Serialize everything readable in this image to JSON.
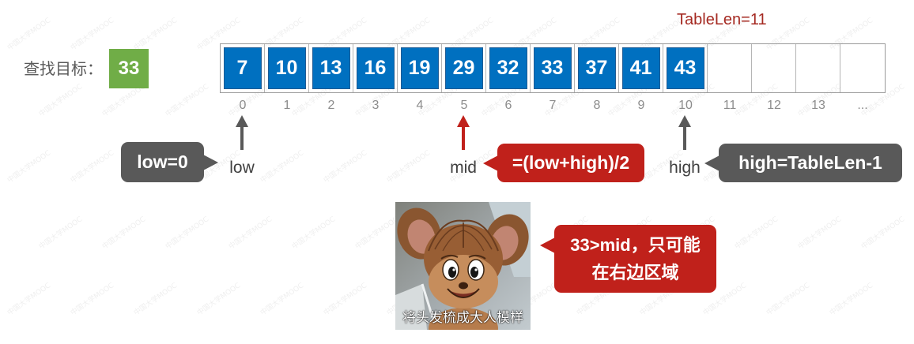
{
  "slide": {
    "table_len_label": "TableLen=11"
  },
  "search": {
    "label": "查找目标：",
    "target": "33"
  },
  "array": {
    "values": [
      "7",
      "10",
      "13",
      "16",
      "19",
      "29",
      "32",
      "33",
      "37",
      "41",
      "43"
    ],
    "indices": [
      "0",
      "1",
      "2",
      "3",
      "4",
      "5",
      "6",
      "7",
      "8",
      "9",
      "10",
      "11",
      "12",
      "13",
      "..."
    ]
  },
  "pointers": {
    "low": {
      "label": "low",
      "index": 0,
      "callout": "low=0",
      "color": "#595959"
    },
    "mid": {
      "label": "mid",
      "index": 5,
      "callout": "=(low+high)/2",
      "color": "#C0211B"
    },
    "high": {
      "label": "high",
      "index": 10,
      "callout": "high=TableLen-1",
      "color": "#595959"
    }
  },
  "meme": {
    "caption": "将头发梳成大人模样",
    "callout_lines": [
      "33>mid，只可能",
      "在右边区域"
    ]
  },
  "watermark": "中国大学MOOC",
  "colors": {
    "cell_fill": "#0070C0",
    "target_fill": "#70AD47",
    "callout_gray": "#595959",
    "callout_red": "#C0211B",
    "title_red": "#A52A22"
  }
}
